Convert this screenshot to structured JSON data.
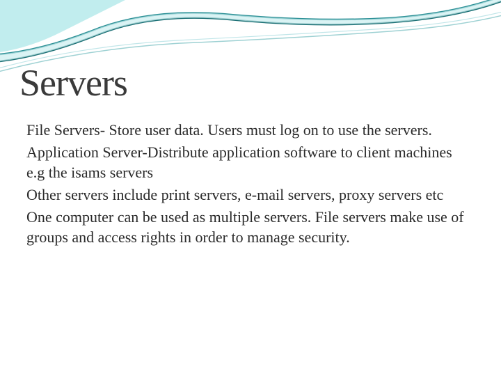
{
  "slide": {
    "title": "Servers",
    "paragraphs": [
      "File Servers- Store user data. Users must log on to use the servers.",
      "Application Server-Distribute application software to client machines e.g the isams servers",
      "Other servers include print servers, e-mail servers, proxy servers etc",
      "One computer can be used as multiple servers. File servers make use of groups and access rights in order to manage security."
    ]
  }
}
